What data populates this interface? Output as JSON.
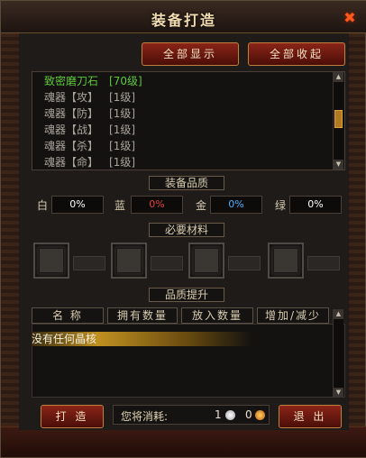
{
  "window": {
    "title": "装备打造"
  },
  "toolbar": {
    "show_all": "全部显示",
    "collapse_all": "全部收起"
  },
  "list": {
    "items": [
      {
        "name": "致密磨刀石",
        "level": "[70级]",
        "color": "#5ec83a"
      },
      {
        "name": "魂器【攻】",
        "level": "[1级]",
        "color": "#a9a39a"
      },
      {
        "name": "魂器【防】",
        "level": "[1级]",
        "color": "#a9a39a"
      },
      {
        "name": "魂器【战】",
        "level": "[1级]",
        "color": "#a9a39a"
      },
      {
        "name": "魂器【杀】",
        "level": "[1级]",
        "color": "#a9a39a"
      },
      {
        "name": "魂器【命】",
        "level": "[1级]",
        "color": "#a9a39a"
      }
    ]
  },
  "quality": {
    "label": "装备品质",
    "white": {
      "letter": "白",
      "value": "0%",
      "color": "#ffffff"
    },
    "blue": {
      "letter": "蓝",
      "value": "0%",
      "color": "#e04040"
    },
    "gold": {
      "letter": "金",
      "value": "0%",
      "color": "#4ab0ff"
    },
    "green": {
      "letter": "绿",
      "value": "0%",
      "color": "#ffffff"
    }
  },
  "materials": {
    "label": "必要材料"
  },
  "upgrade": {
    "label": "品质提升",
    "columns": [
      "名 称",
      "拥有数量",
      "放入数量",
      "增加/减少"
    ],
    "empty_text": "没有任何晶核"
  },
  "footer": {
    "forge": "打 造",
    "cost_label": "您将消耗:",
    "coin1_amount": "1",
    "coin2_amount": "0",
    "exit": "退 出"
  }
}
